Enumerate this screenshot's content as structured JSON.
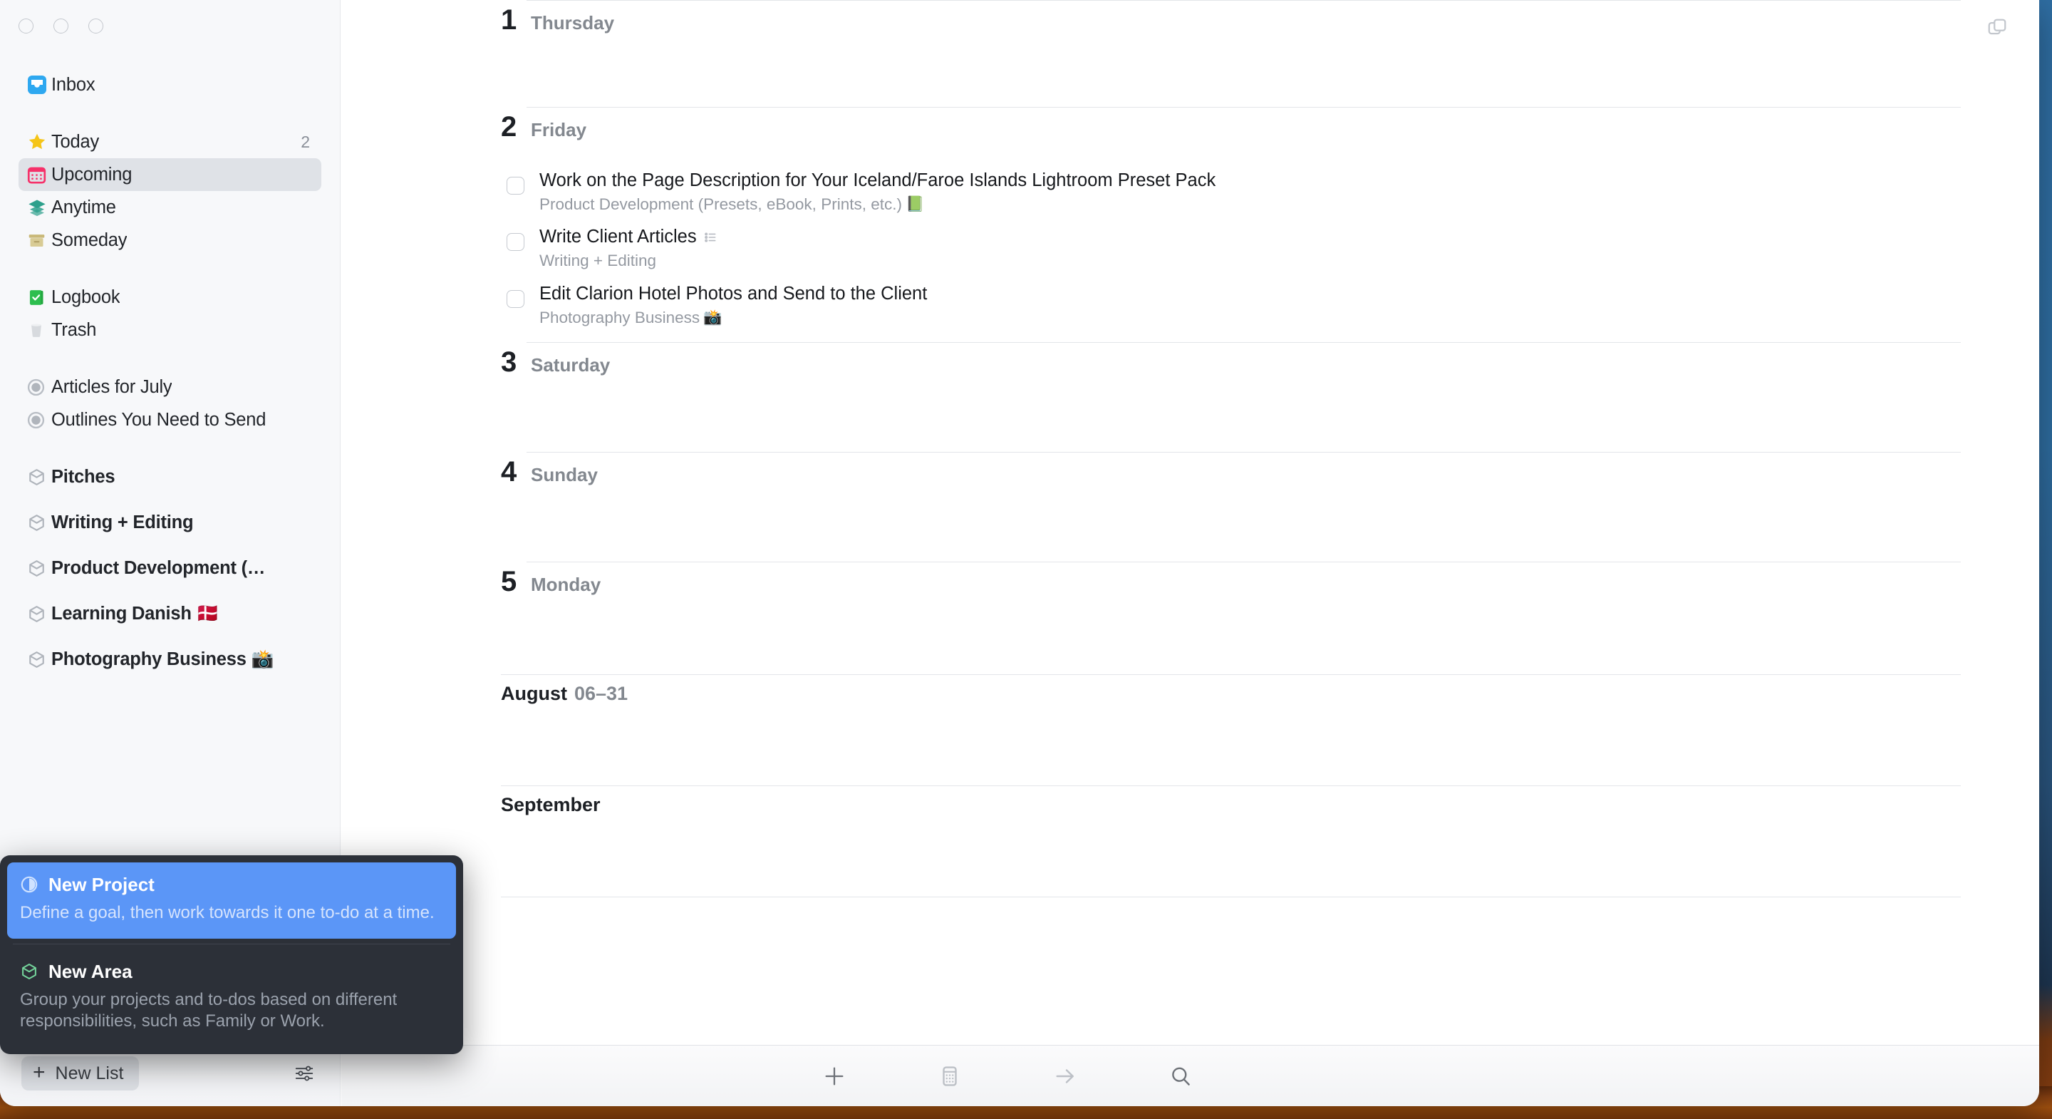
{
  "window": {
    "title": "Things",
    "traffic_lights": [
      "close",
      "minimize",
      "zoom"
    ],
    "split_view_icon": "split-view-icon"
  },
  "sidebar": {
    "top_items": [
      {
        "id": "inbox",
        "label": "Inbox",
        "icon": "inbox-icon",
        "count": "",
        "bold": false,
        "selected": false
      }
    ],
    "list_items": [
      {
        "id": "today",
        "label": "Today",
        "icon": "star-icon",
        "count": "2",
        "bold": false,
        "selected": false
      },
      {
        "id": "upcoming",
        "label": "Upcoming",
        "icon": "calendar-icon",
        "count": "",
        "bold": false,
        "selected": true
      },
      {
        "id": "anytime",
        "label": "Anytime",
        "icon": "layers-icon",
        "count": "",
        "bold": false,
        "selected": false
      },
      {
        "id": "someday",
        "label": "Someday",
        "icon": "archive-box-icon",
        "count": "",
        "bold": false,
        "selected": false
      }
    ],
    "archive_items": [
      {
        "id": "logbook",
        "label": "Logbook",
        "icon": "logbook-icon",
        "count": "",
        "bold": false,
        "selected": false
      },
      {
        "id": "trash",
        "label": "Trash",
        "icon": "trash-icon",
        "count": "",
        "bold": false,
        "selected": false
      }
    ],
    "project_items": [
      {
        "id": "articles-for-july",
        "label": "Articles for July",
        "icon": "project-circle-icon",
        "count": "",
        "bold": false,
        "selected": false
      },
      {
        "id": "outlines-you-need-to-send",
        "label": "Outlines You Need to Send",
        "icon": "project-circle-icon",
        "count": "",
        "bold": false,
        "selected": false
      }
    ],
    "area_items": [
      {
        "id": "pitches",
        "label": "Pitches",
        "icon": "area-hex-icon",
        "count": "",
        "bold": true,
        "selected": false
      },
      {
        "id": "writing-editing",
        "label": "Writing + Editing",
        "icon": "area-hex-icon",
        "count": "",
        "bold": true,
        "selected": false
      },
      {
        "id": "product-development",
        "label": "Product Development (…",
        "icon": "area-hex-icon",
        "count": "",
        "bold": true,
        "selected": false
      },
      {
        "id": "learning-danish",
        "label": "Learning Danish 🇩🇰",
        "icon": "area-hex-icon",
        "count": "",
        "bold": true,
        "selected": false
      },
      {
        "id": "photography-business",
        "label": "Photography Business 📸",
        "icon": "area-hex-icon",
        "count": "",
        "bold": true,
        "selected": false
      }
    ],
    "footer": {
      "new_list_label": "New List",
      "new_list_icon": "plus-icon",
      "settings_icon": "sliders-icon"
    },
    "popup": {
      "items": [
        {
          "id": "new-project",
          "icon": "project-pie-icon",
          "title": "New Project",
          "description": "Define a goal, then work towards it one to-do at a time.",
          "highlighted": true
        },
        {
          "id": "new-area",
          "icon": "area-hex-icon",
          "title": "New Area",
          "description": "Group your projects and to-dos based on different responsibilities, such as Family or Work.",
          "highlighted": false
        }
      ]
    }
  },
  "main": {
    "days": [
      {
        "id": "day-1",
        "num": "1",
        "name": "Thursday",
        "tasks": []
      },
      {
        "id": "day-2",
        "num": "2",
        "name": "Friday",
        "tasks": [
          {
            "id": "task-preset-pack",
            "title": "Work on the Page Description for Your Iceland/Faroe Islands Lightroom Preset Pack",
            "title_badge": "",
            "subtitle": "Product Development (Presets, eBook, Prints, etc.)",
            "subtitle_emoji": "📗",
            "checked": false
          },
          {
            "id": "task-client-articles",
            "title": "Write Client Articles",
            "title_badge": "checklist-icon",
            "subtitle": "Writing + Editing",
            "subtitle_emoji": "",
            "checked": false
          },
          {
            "id": "task-clarion-photos",
            "title": "Edit Clarion Hotel Photos and Send to the Client",
            "title_badge": "",
            "subtitle": "Photography Business",
            "subtitle_emoji": "📸",
            "checked": false
          }
        ]
      },
      {
        "id": "day-3",
        "num": "3",
        "name": "Saturday",
        "tasks": []
      },
      {
        "id": "day-4",
        "num": "4",
        "name": "Sunday",
        "tasks": []
      },
      {
        "id": "day-5",
        "num": "5",
        "name": "Monday",
        "tasks": []
      }
    ],
    "months": [
      {
        "id": "month-august",
        "name": "August",
        "range": "06–31"
      },
      {
        "id": "month-september",
        "name": "September",
        "range": ""
      }
    ]
  },
  "toolbar": {
    "buttons": [
      {
        "id": "add",
        "icon": "plus-icon"
      },
      {
        "id": "calendar",
        "icon": "calendar-outline-icon"
      },
      {
        "id": "move",
        "icon": "arrow-right-icon"
      },
      {
        "id": "search",
        "icon": "search-icon"
      }
    ]
  },
  "colors": {
    "sidebar_bg": "#F7F8FA",
    "selection_bg": "#DFE2E7",
    "popup_bg": "#2C3038",
    "popup_highlight": "#5B96F7",
    "inbox_blue": "#2EA8F0",
    "today_yellow": "#F5C518",
    "upcoming_pink": "#F6316A",
    "anytime_teal": "#2DA08C",
    "someday_tan": "#C9B878",
    "logbook_green": "#2DBE4E",
    "text_primary": "#16181C",
    "text_muted": "#9499A1"
  }
}
